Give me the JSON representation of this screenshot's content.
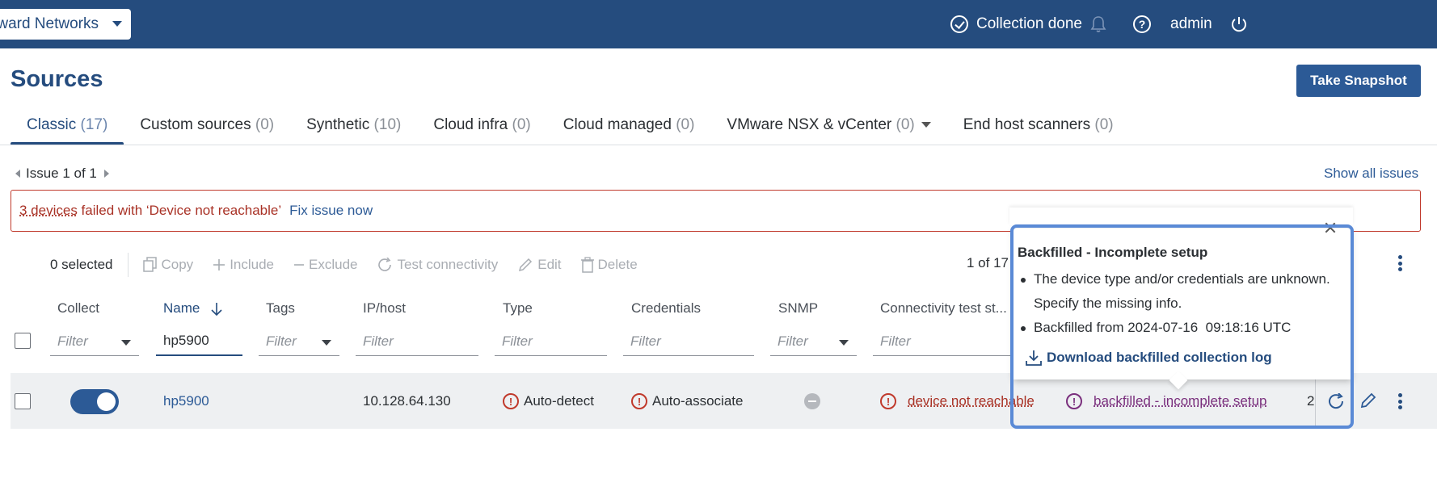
{
  "topbar": {
    "network_select": "Forward Networks",
    "collection_status": "Collection done",
    "user": "admin"
  },
  "page": {
    "title": "Sources",
    "snapshot_button": "Take Snapshot"
  },
  "tabs": [
    {
      "label": "Classic",
      "count": "(17)",
      "active": true
    },
    {
      "label": "Custom sources",
      "count": "(0)"
    },
    {
      "label": "Synthetic",
      "count": "(10)"
    },
    {
      "label": "Cloud infra",
      "count": "(0)"
    },
    {
      "label": "Cloud managed",
      "count": "(0)"
    },
    {
      "label": "VMware NSX & vCenter",
      "count": "(0)"
    },
    {
      "label": "End host scanners",
      "count": "(0)"
    }
  ],
  "issues": {
    "pager": "Issue 1 of 1",
    "show_all": "Show all issues",
    "banner_devices": "3 devices",
    "banner_message": " failed with ‘Device not reachable’",
    "fix_link": "Fix issue now"
  },
  "toolbar": {
    "selected": "0 selected",
    "copy": "Copy",
    "include": "Include",
    "exclude": "Exclude",
    "test_connectivity": "Test connectivity",
    "edit": "Edit",
    "delete": "Delete",
    "pagination": "1 of 17"
  },
  "table": {
    "headers": {
      "collect": "Collect",
      "name": "Name",
      "tags": "Tags",
      "ip_host": "IP/host",
      "type": "Type",
      "credentials": "Credentials",
      "snmp": "SNMP",
      "connectivity": "Connectivity test st..."
    },
    "filter_placeholder": "Filter",
    "name_filter_value": "hp5900",
    "row": {
      "name": "hp5900",
      "ip": "10.128.64.130",
      "type": "Auto-detect",
      "credentials": "Auto-associate",
      "connectivity": "device not reachable",
      "status": "backfilled - incomplete setup",
      "extra": "2"
    }
  },
  "popover": {
    "title": "Backfilled - Incomplete setup",
    "bullets": [
      "The device type and/or credentials are unknown. Specify the missing info.",
      "Backfilled from 2024-07-16  09:18:16 UTC"
    ],
    "download": "Download backfilled collection log"
  },
  "colors": {
    "brand": "#254c7e",
    "accent": "#2c5a96",
    "error": "#c0392b",
    "highlight": "#5a8ad6"
  }
}
